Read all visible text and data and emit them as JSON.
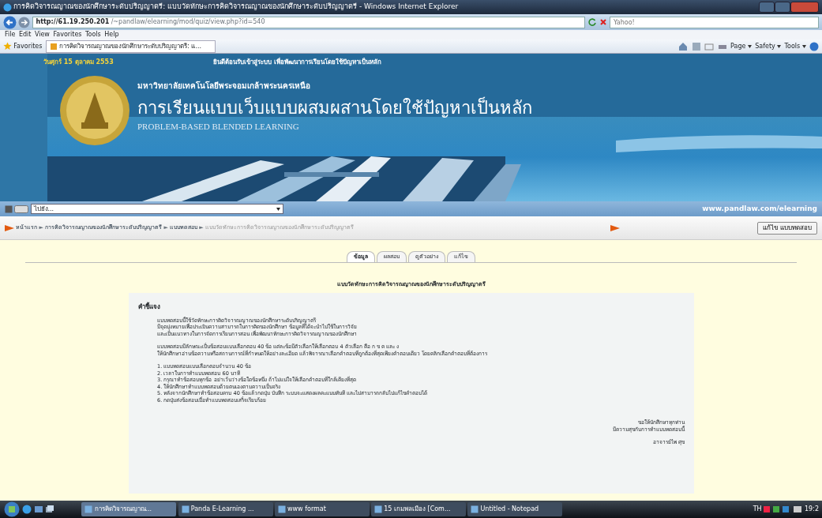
{
  "window": {
    "title": "การคิดวิจารณญาณของนักศึกษาระดับปริญญาตรี: แบบวัดทักษะการคิดวิจารณญาณของนักศึกษาระดับปริญญาตรี - Windows Internet Explorer"
  },
  "browser": {
    "url_host": "http://61.19.250.201",
    "url_path": "/~pandlaw/elearning/mod/quiz/view.php?id=540",
    "search_placeholder": "Yahoo!",
    "menu": [
      "File",
      "Edit",
      "View",
      "Favorites",
      "Tools",
      "Help"
    ],
    "favorites": "Favorites",
    "tab": "การคิดวิจารณญาณของนักศึกษาระดับปริญญาตรี: แ...",
    "tools": [
      "Page",
      "Safety",
      "Tools"
    ]
  },
  "banner": {
    "date": "วันศุกร์ 15 ตุลาคม 2553",
    "marquee": "ยินดีต้อนรับเข้าสู่ระบบ เพื่อพัฒนาการเรียนโดยใช้ปัญหาเป็นหลัก",
    "university": "มหาวิทยาลัยเทคโนโลยีพระจอมเกล้าพระนครเหนือ",
    "title": "การเรียนแบบเว็บแบบผสมผสานโดยใช้ปัญหาเป็นหลัก",
    "subtitle": "PROBLEM-BASED BLENDED LEARNING"
  },
  "jumpbar": {
    "select": "ไปยัง...",
    "site": "www.pandlaw.com/elearning"
  },
  "breadcrumb": {
    "items": [
      {
        "label": "หน้าแรก",
        "current": false
      },
      {
        "label": "การคิดวิจารณญาณของนักศึกษาระดับปริญญาตรี",
        "current": false
      },
      {
        "label": "แบบทดสอบ",
        "current": false
      },
      {
        "label": "แบบวัดทักษะการคิดวิจารณญาณของนักศึกษาระดับปริญญาตรี",
        "current": true
      }
    ],
    "separator": "►",
    "button": "แก้ไข แบบทดสอบ"
  },
  "tabs": [
    {
      "label": "ข้อมูล",
      "selected": true
    },
    {
      "label": "ผลสอบ",
      "selected": false
    },
    {
      "label": "ดูตัวอย่าง",
      "selected": false
    },
    {
      "label": "แก้ไข",
      "selected": false
    }
  ],
  "heading": "แบบวัดทักษะการคิดวิจารณญาณของนักศึกษาระดับปริญญาตรี",
  "instructions": {
    "title": "คำชี้แจง",
    "paragraphs": [
      [
        "แบบทดสอบนี้ใช้วัดทักษะการคิดวิจารณญาณของนักศึกษาระดับปริญญาตรี",
        "มีจุดมุ่งหมายเพื่อประเมินความสามารถในการคิดของนักศึกษา ข้อมูลที่ได้จะนำไปใช้ในการวิจัย",
        "และเป็นแนวทางในการจัดการเรียนการสอน เพื่อพัฒนาทักษะการคิดวิจารณญาณของนักศึกษา"
      ],
      [
        "แบบทดสอบมีลักษณะเป็นข้อสอบแบบเลือกตอบ 40 ข้อ แต่ละข้อมีตัวเลือกให้เลือกตอบ 4 ตัวเลือก คือ ก ข ค และ ง",
        "ให้นักศึกษาอ่านข้อความหรือสถานการณ์ที่กำหนดให้อย่างละเอียด แล้วพิจารณาเลือกคำตอบที่ถูกต้องที่สุดเพียงคำตอบเดียว โดยคลิกเลือกคำตอบที่ต้องการ"
      ]
    ],
    "rules": [
      {
        "number": "1.",
        "text": "แบบทดสอบแบบเลือกตอบจำนวน 40 ข้อ"
      },
      {
        "number": "2.",
        "text": "เวลาในการทำแบบทดสอบ 60 นาที"
      },
      {
        "number": "3.",
        "text": "กรุณาทำข้อสอบทุกข้อ อย่าเว้นว่างข้อใดข้อหนึ่ง ถ้าไม่แน่ใจให้เลือกคำตอบที่ใกล้เคียงที่สุด"
      },
      {
        "number": "4.",
        "text": "ให้นักศึกษาทำแบบทดสอบด้วยตนเองตามความเป็นจริง"
      },
      {
        "number": "5.",
        "text": "หลังจากนักศึกษาทำข้อสอบครบ 40 ข้อแล้วกดปุ่ม บันทึก ระบบจะแสดงผลคะแนนทันที และไม่สามารถกลับไปแก้ไขคำตอบได้"
      },
      {
        "number": "6.",
        "text": "กดปุ่มส่งข้อสอบเมื่อทำแบบทดสอบเสร็จเรียบร้อย"
      }
    ],
    "signature": [
      "ขอให้นักศึกษาทุกท่าน",
      "มีความสุขกับการทำแบบทดสอบนี้",
      "อาจารย์ไพ ศุข"
    ]
  },
  "taskbar": {
    "tasks": [
      {
        "label": "การคิดวิจารณญาณ...",
        "selected": true
      },
      {
        "label": "Panda E-Learning ...",
        "selected": false
      },
      {
        "label": "www format",
        "selected": false
      },
      {
        "label": "15 เกมพลเมือง [Com...",
        "selected": false
      },
      {
        "label": "Untitled - Notepad",
        "selected": false
      }
    ],
    "language": "TH",
    "clock": "19:2"
  }
}
